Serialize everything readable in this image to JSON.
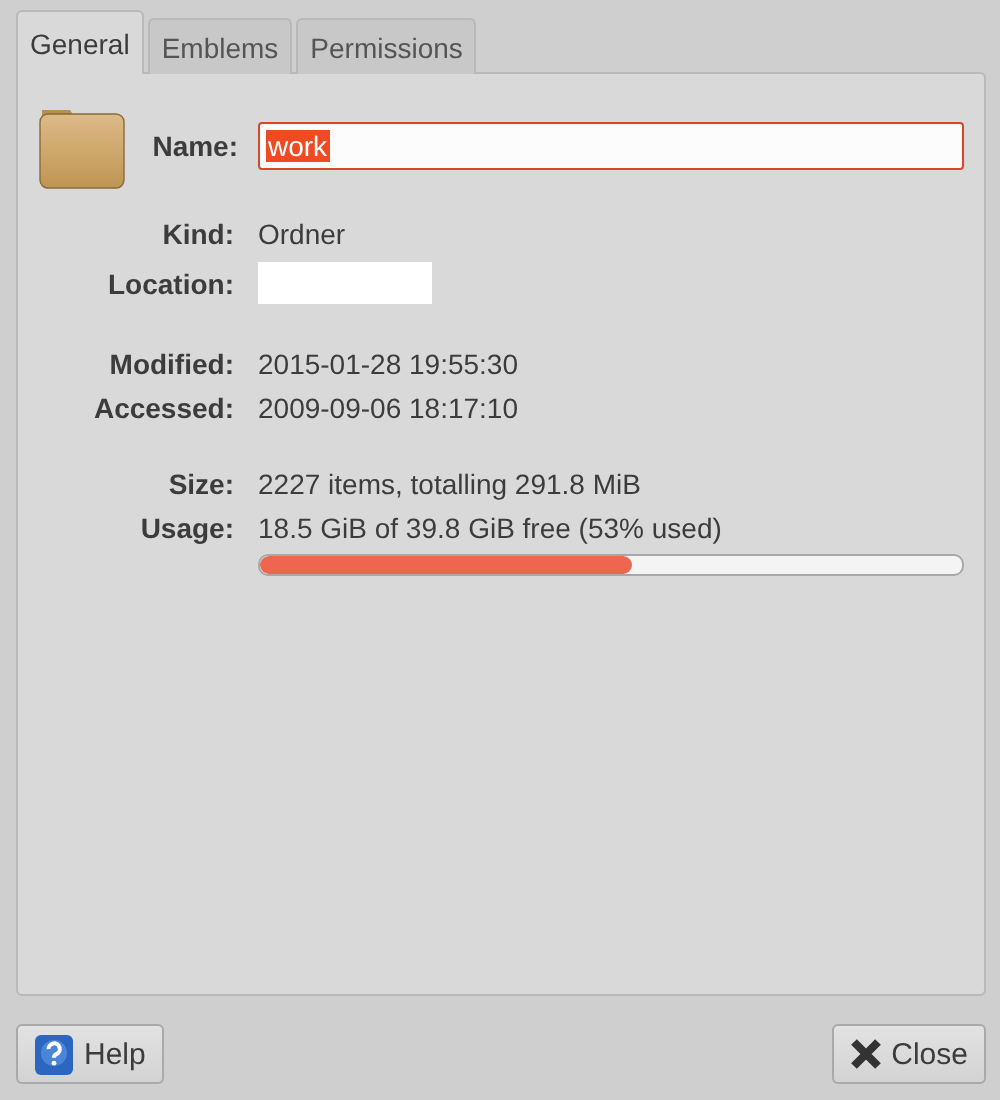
{
  "tabs": [
    {
      "label": "General",
      "selected": true
    },
    {
      "label": "Emblems",
      "selected": false
    },
    {
      "label": "Permissions",
      "selected": false
    }
  ],
  "name_field": {
    "label": "Name:",
    "value": "work",
    "selected": true
  },
  "groups": [
    {
      "rows": [
        {
          "kind": "text",
          "label": "Kind:",
          "value": "Ordner"
        },
        {
          "kind": "blank",
          "label": "Location:"
        }
      ]
    },
    {
      "rows": [
        {
          "kind": "text",
          "label": "Modified:",
          "value": "2015-01-28 19:55:30"
        },
        {
          "kind": "text",
          "label": "Accessed:",
          "value": "2009-09-06 18:17:10"
        }
      ]
    },
    {
      "rows": [
        {
          "kind": "text",
          "label": "Size:",
          "value": "2227 items, totalling 291.8 MiB"
        },
        {
          "kind": "meter",
          "label": "Usage:",
          "value": "18.5 GiB of 39.8 GiB free (53% used)",
          "level": 0.53
        }
      ]
    }
  ],
  "buttons": [
    {
      "kind": "help",
      "label": "Help"
    },
    {
      "kind": "close",
      "label": "Close"
    }
  ]
}
